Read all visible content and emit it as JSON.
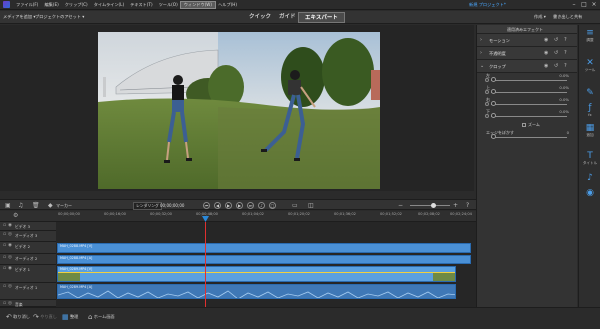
{
  "menubar": {
    "items": [
      "ファイル(F)",
      "編集(E)",
      "クリップ(C)",
      "タイムライン(L)",
      "テキスト(T)",
      "ツール(O)",
      "ウィンドウ(W)",
      "ヘルプ(H)"
    ],
    "active_index": 6,
    "title": "新規 プロジェクト*"
  },
  "modebar": {
    "left_dropdown": "メディアを追加 ▾",
    "project_assets": "プロジェクトのアセット ▾",
    "tabs": [
      "クイック",
      "ガイド",
      "エキスパート"
    ],
    "active_tab": 2,
    "right_label1": "作成 ▾",
    "right_label2": "書き出しと共有"
  },
  "effects_panel": {
    "header": "適用済みエフェクト",
    "sections": [
      {
        "label": "モーション"
      },
      {
        "label": "不透明度"
      },
      {
        "label": "クロップ"
      }
    ],
    "sliders": [
      {
        "label": "左",
        "value": "0.0%",
        "pos": 0.02
      },
      {
        "label": "上",
        "value": "0.0%",
        "pos": 0.02
      },
      {
        "label": "右",
        "value": "0.0%",
        "pos": 0.02
      },
      {
        "label": "下",
        "value": "0.0%",
        "pos": 0.02
      }
    ],
    "zoom_label": "ズーム",
    "edge_label": "エッジをぼかす",
    "edge_value": "0",
    "edge_pos": 0.02
  },
  "right_tools": [
    {
      "icon": "adjust-icon",
      "glyph": "≡",
      "label": "調整"
    },
    {
      "icon": "tools-icon",
      "glyph": "✕",
      "label": "ツール"
    },
    {
      "icon": "transitions-icon",
      "glyph": "✎",
      "label": ""
    },
    {
      "icon": "effects-icon",
      "glyph": "ƒ",
      "label": "fx"
    },
    {
      "icon": "color-icon",
      "glyph": "▦",
      "label": "追加"
    },
    {
      "icon": "title-icon",
      "glyph": "T",
      "label": "タイトル"
    },
    {
      "icon": "music-icon",
      "glyph": "♪",
      "label": ""
    },
    {
      "icon": "graphics-icon",
      "glyph": "◉",
      "label": ""
    }
  ],
  "timeline_toolbar": {
    "marker": "マーカー",
    "render": "レンダリング",
    "timecode": "00;00;00;00"
  },
  "ruler": {
    "labels": [
      "00;00;00;00",
      "00;00;16;00",
      "00;00;32;00",
      "00;00;48;00",
      "00;01;04;02",
      "00;01;20;02",
      "00;01;36;02",
      "00;01;52;02",
      "00;02;08;02",
      "00;02;24;04"
    ]
  },
  "tracks": [
    {
      "name": "ビデオ 3"
    },
    {
      "name": "オーディオ 3"
    },
    {
      "name": "ビデオ 2"
    },
    {
      "name": "オーディオ 2"
    },
    {
      "name": "ビデオ 1"
    },
    {
      "name": "オーディオ 1"
    },
    {
      "name": "音楽"
    }
  ],
  "clips": {
    "v2": "MAH_0288.MP4 [V]",
    "a2": "MAH_0288.MP4 [A]",
    "v1": "MAH_0289.MP4 [V]",
    "a1": "MAH_0289.MP4 [A]"
  },
  "bottombar": {
    "undo": "取り消し",
    "redo": "やり直し",
    "organizer": "整理",
    "home": "ホーム画面"
  }
}
